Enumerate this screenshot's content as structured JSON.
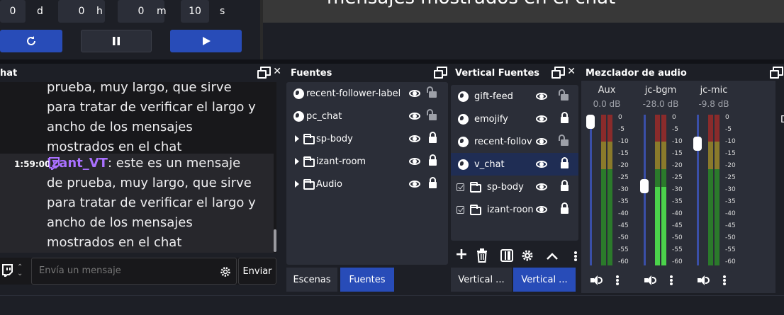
{
  "timer": {
    "days": "0",
    "days_unit": "d",
    "hours": "0",
    "hours_unit": "h",
    "minutes": "0",
    "minutes_unit": "m",
    "seconds": "10",
    "seconds_unit": "s"
  },
  "preview": {
    "text": "mensajes mostrados en el chat"
  },
  "chat": {
    "title": "hat",
    "message1": "prueba, muy largo, que sirve para tratar de verificar el largo y ancho de los mensajes mostrados en el chat",
    "time2": "1:59:00",
    "user2": "Izant_VT",
    "message2": ": este es un mensaje de prueba, muy largo, que sirve para tratar de verificar el largo y ancho de los mensajes mostrados en el chat",
    "input_placeholder": "Envía un mensaje",
    "send_label": "Enviar"
  },
  "sources": {
    "title": "Fuentes",
    "items": [
      {
        "name": "recent-follower-label",
        "type": "browser",
        "locked": false
      },
      {
        "name": "pc_chat",
        "type": "browser",
        "locked": false
      },
      {
        "name": "sp-body",
        "type": "group",
        "locked": true
      },
      {
        "name": "izant-room",
        "type": "group",
        "locked": true
      },
      {
        "name": "Audio",
        "type": "group",
        "locked": true
      }
    ],
    "tabs": [
      "Escenas",
      "Fuentes"
    ]
  },
  "vertical_sources": {
    "title": "Vertical Fuentes",
    "items": [
      {
        "name": "gift-feed",
        "type": "browser",
        "locked": false
      },
      {
        "name": "emojify",
        "type": "browser",
        "locked": true
      },
      {
        "name": "recent-follov",
        "type": "browser",
        "locked": false
      },
      {
        "name": "v_chat",
        "type": "browser",
        "locked": true,
        "selected": true
      },
      {
        "name": "sp-body",
        "type": "group",
        "locked": true
      },
      {
        "name": "izant-roon",
        "type": "group",
        "locked": true
      }
    ],
    "tabs": [
      "Vertical ...",
      "Vertical ..."
    ]
  },
  "mixer": {
    "title": "Mezclador de audio",
    "channels": [
      {
        "name": "Aux",
        "db": "0.0 dB",
        "fader_level": 1.0
      },
      {
        "name": "jc-bgm",
        "db": "-28.0 dB",
        "fader_level": 0.53
      },
      {
        "name": "jc-mic",
        "db": "-9.8 dB",
        "fader_level": 0.84
      }
    ],
    "scale": [
      "0",
      "-5",
      "-10",
      "-15",
      "-20",
      "-25",
      "-30",
      "-35",
      "-40",
      "-45",
      "-50",
      "-55",
      "-60"
    ]
  },
  "colors": {
    "panel_bg": "#1d1f26",
    "list_bg": "#2b2e38",
    "accent": "#284cb8",
    "twitch_purple": "#a970ff",
    "meter_green": "#4bd24b",
    "meter_yellow": "#d2d24b",
    "meter_red": "#d24b4b"
  }
}
